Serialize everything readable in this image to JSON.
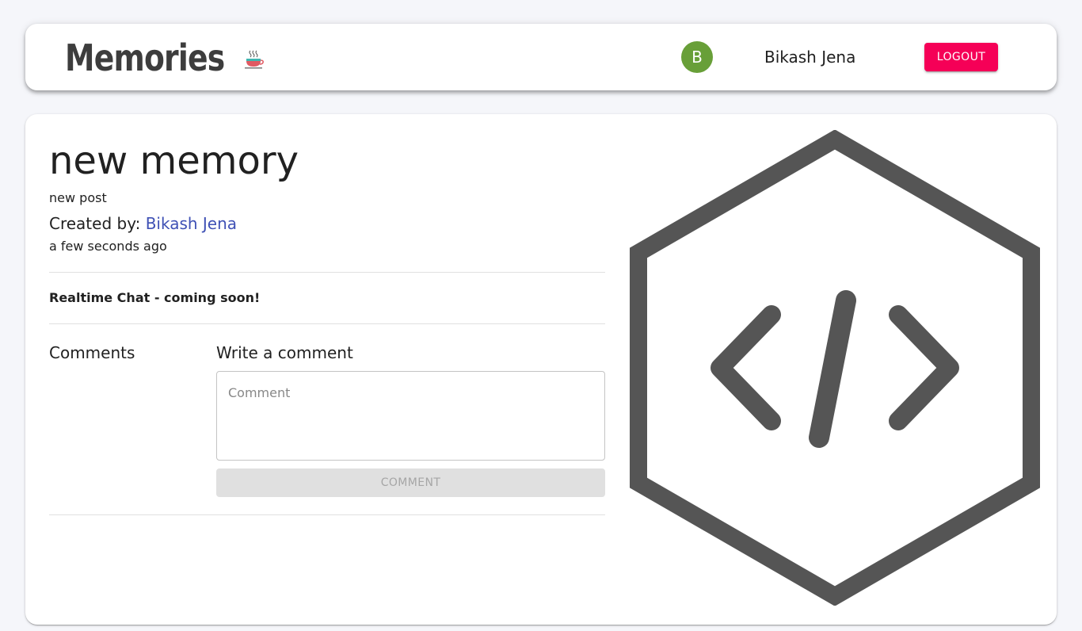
{
  "header": {
    "brand": "Memories",
    "user": {
      "initial": "B",
      "name": "Bikash Jena",
      "avatar_color": "#689f38"
    },
    "logout_label": "LOGOUT"
  },
  "post": {
    "title": "new memory",
    "tags": "new post",
    "created_by_label": "Created by: ",
    "creator": "Bikash Jena",
    "time": "a few seconds ago",
    "chat_notice": "Realtime Chat - coming soon!",
    "image_icon": "code-hexagon-icon"
  },
  "comments": {
    "heading": "Comments",
    "write_heading": "Write a comment",
    "placeholder": "Comment",
    "value": "",
    "button_label": "COMMENT"
  },
  "colors": {
    "accent": "#f50057",
    "link": "#3f51b5",
    "background": "#f5f6fa"
  }
}
